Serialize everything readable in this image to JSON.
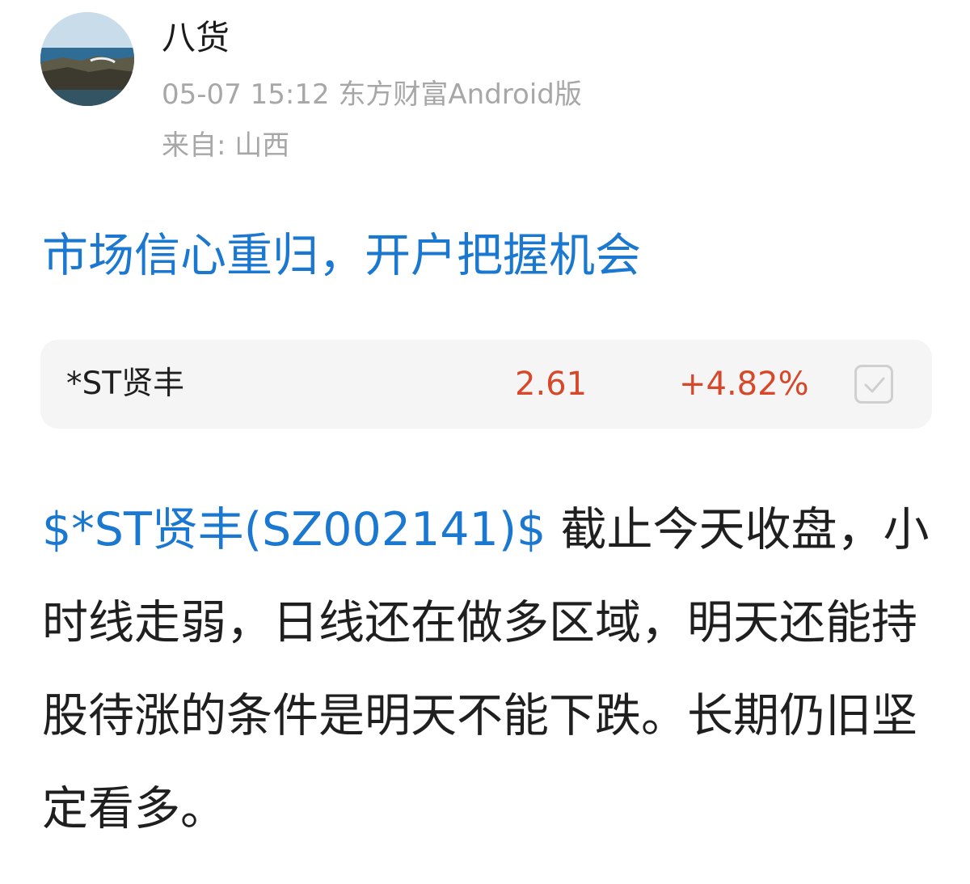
{
  "post": {
    "author": {
      "name": "八货",
      "avatar_icon": "avatar-seaside-icon"
    },
    "meta": {
      "timestamp": "05-07 15:12",
      "source": "东方财富Android版",
      "location": "来自: 山西"
    },
    "title": "市场信心重归，开户把握机会",
    "stock_card": {
      "name": "*ST贤丰",
      "price": "2.61",
      "change": "+4.82%",
      "checkbox_icon": "checkbox-icon",
      "price_color": "#d7482b"
    },
    "body": {
      "stock_tag": "$*ST贤丰(SZ002141)$",
      "text": "截止今天收盘，小时线走弱，日线还在做多区域，明天还能持股待涨的条件是明天不能下跌。长期仍旧坚定看多。"
    }
  },
  "colors": {
    "link_blue": "#1b78d0",
    "meta_gray": "#a7a7a7",
    "card_bg": "#f5f5f5"
  }
}
